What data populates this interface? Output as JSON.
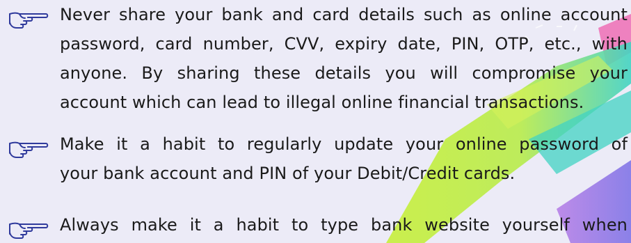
{
  "bullets": [
    {
      "icon": "pointing-hand-icon",
      "lines": [
        "Never share your bank and card details such as online account",
        "password, card number, CVV, expiry date, PIN, OTP, etc., with",
        "anyone. By sharing these details you will compromise your",
        "account which can  lead to illegal online financial transactions."
      ]
    },
    {
      "icon": "pointing-hand-icon",
      "lines": [
        "Make it a habit to regularly update your online password of",
        "your bank account and PIN of your Debit/Credit cards."
      ]
    },
    {
      "icon": "pointing-hand-icon",
      "lines": [
        "Always make it a habit to type bank website yourself when"
      ]
    }
  ],
  "colors": {
    "background": "#ecebf7",
    "text": "#1a1a1a",
    "highlight_green": "#c7ef3a",
    "highlight_teal": "#42d3c3",
    "highlight_purple": "#b47ae6",
    "highlight_pink": "#ef6fb5"
  }
}
